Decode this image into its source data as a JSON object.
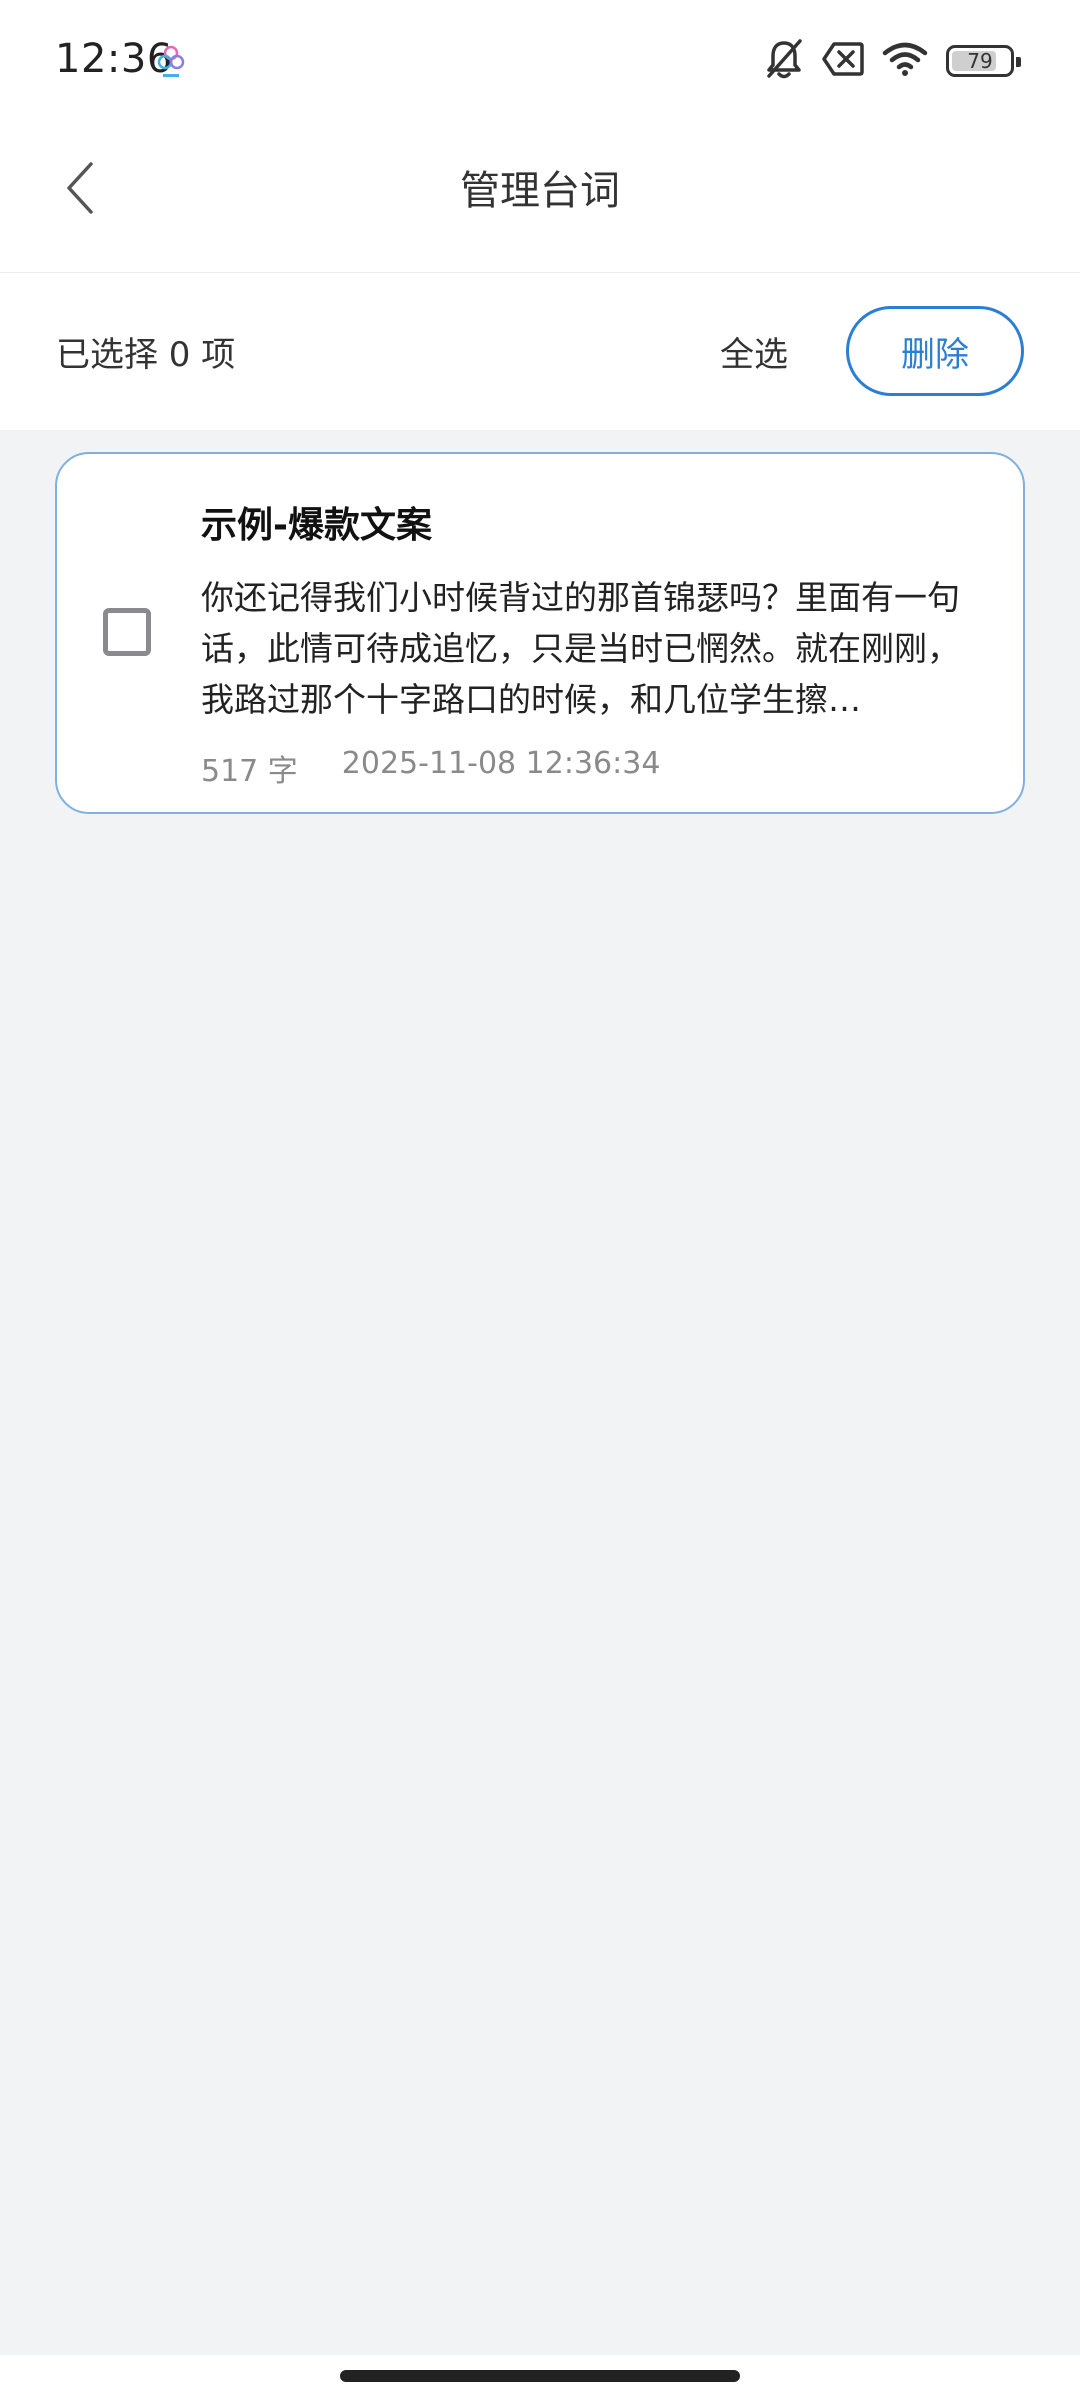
{
  "status_bar": {
    "time": "12:36",
    "battery_level": "79",
    "battery_fraction": 0.79,
    "icons": [
      "app-notification-icon",
      "mute-bell-icon",
      "no-sim-icon",
      "wifi-icon",
      "battery-icon"
    ]
  },
  "nav": {
    "title": "管理台词"
  },
  "selection": {
    "count_text": "已选择 0 项",
    "select_all_label": "全选",
    "delete_label": "删除"
  },
  "items": [
    {
      "title": "示例-爆款文案",
      "preview": "你还记得我们小时候背过的那首锦瑟吗？里面有一句话，此情可待成追忆，只是当时已惘然。就在刚刚，我路过那个十字路口的时候，和几位学生擦…",
      "word_count": "517 字",
      "timestamp": "2025-11-08 12:36:34",
      "checked": false
    }
  ],
  "colors": {
    "accent": "#2a7fd4",
    "background": "#f2f3f5",
    "card_border": "#7fb0e0"
  }
}
